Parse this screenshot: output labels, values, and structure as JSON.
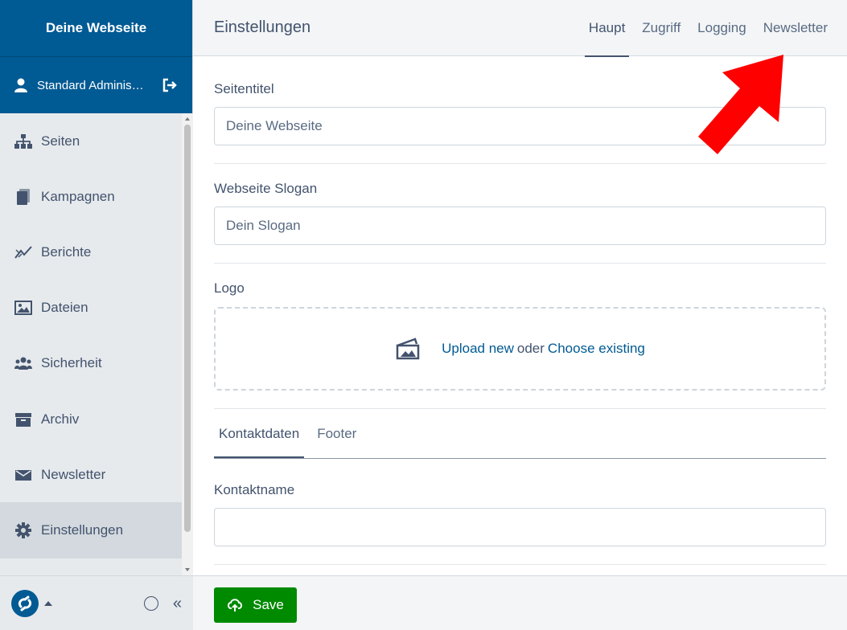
{
  "sidebar": {
    "brand": "Deine Webseite",
    "user_name": "Standard Adminis…",
    "items": [
      {
        "label": "Seiten",
        "icon": "sitemap-icon"
      },
      {
        "label": "Kampagnen",
        "icon": "pages-icon"
      },
      {
        "label": "Berichte",
        "icon": "chart-line-icon"
      },
      {
        "label": "Dateien",
        "icon": "image-icon"
      },
      {
        "label": "Sicherheit",
        "icon": "users-icon"
      },
      {
        "label": "Archiv",
        "icon": "archive-icon"
      },
      {
        "label": "Newsletter",
        "icon": "envelope-icon"
      },
      {
        "label": "Einstellungen",
        "icon": "gear-icon",
        "active": true
      }
    ],
    "collapse_label": "«"
  },
  "header": {
    "title": "Einstellungen",
    "tabs": [
      {
        "label": "Haupt",
        "active": true
      },
      {
        "label": "Zugriff"
      },
      {
        "label": "Logging"
      },
      {
        "label": "Newsletter"
      }
    ]
  },
  "form": {
    "site_title_label": "Seitentitel",
    "site_title_value": "Deine Webseite",
    "slogan_label": "Webseite Slogan",
    "slogan_value": "Dein Slogan",
    "logo_label": "Logo",
    "upload_new": "Upload new",
    "upload_or": "oder",
    "choose_existing": "Choose existing",
    "subtabs": [
      {
        "label": "Kontaktdaten",
        "active": true
      },
      {
        "label": "Footer"
      }
    ],
    "contact_name_label": "Kontaktname",
    "contact_name_value": ""
  },
  "actions": {
    "save_label": "Save"
  },
  "colors": {
    "brand_blue": "#005a93",
    "save_green": "#008a00",
    "annotation_red": "#ff0000"
  }
}
